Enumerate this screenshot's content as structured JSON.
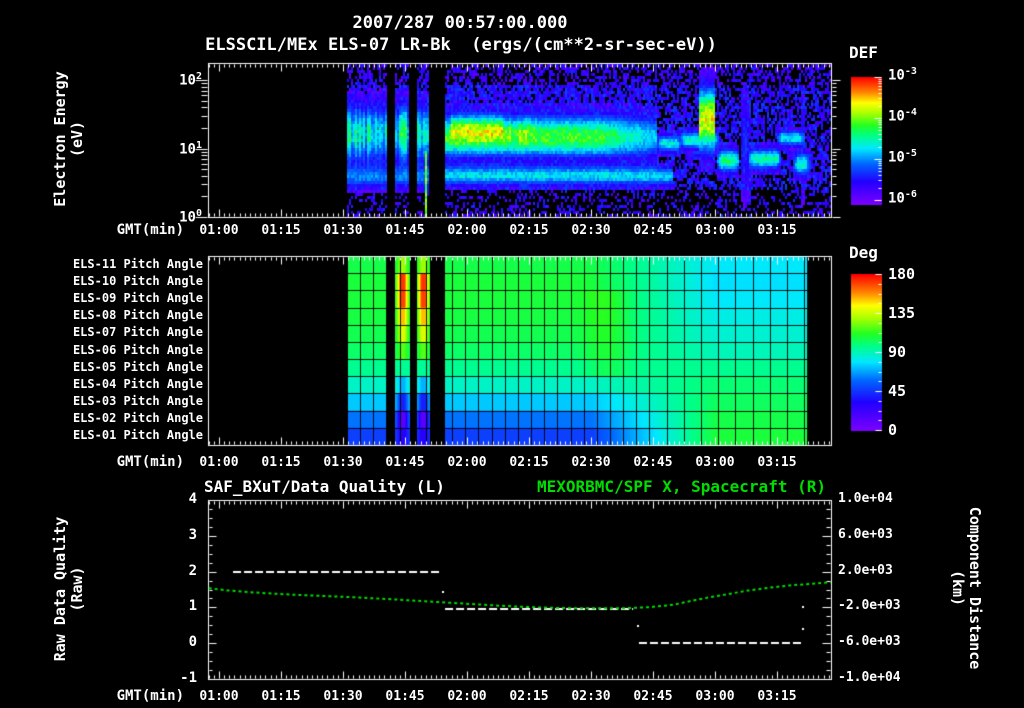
{
  "page": {
    "background": "#000000",
    "text_color": "#ffffff",
    "accent_green": "#00dd00",
    "rainbow_colormap": [
      [
        0.0,
        "#7B00FF"
      ],
      [
        0.18,
        "#2200FF"
      ],
      [
        0.32,
        "#0066FF"
      ],
      [
        0.44,
        "#00E8FF"
      ],
      [
        0.54,
        "#00FF88"
      ],
      [
        0.62,
        "#22FF22"
      ],
      [
        0.72,
        "#AAFF00"
      ],
      [
        0.8,
        "#FFFF00"
      ],
      [
        0.88,
        "#FF8800"
      ],
      [
        1.0,
        "#FF0000"
      ]
    ]
  },
  "header": {
    "title_line1": "2007/287 00:57:00.000",
    "title_line2": "ELSSCIL/MEx ELS-07 LR-Bk  (ergs/(cm**2-sr-sec-eV))"
  },
  "chart_data": [
    {
      "id": "electron-energy-spectrogram",
      "type": "heatmap",
      "x": {
        "label": "GMT(min)",
        "tick_labels": [
          "01:00",
          "01:15",
          "01:30",
          "01:45",
          "02:00",
          "02:15",
          "02:30",
          "02:45",
          "03:00",
          "03:15"
        ],
        "tick_minutes": [
          60,
          75,
          90,
          105,
          120,
          135,
          150,
          165,
          180,
          195
        ],
        "range_minutes": [
          57.34,
          208.06
        ]
      },
      "y": {
        "label_line1": "Electron Energy",
        "label_line2": "(eV)",
        "scale": "log",
        "tick_labels": [
          {
            "base": "10",
            "exp": "2"
          },
          {
            "base": "10",
            "exp": "1"
          },
          {
            "base": "10",
            "exp": "0"
          }
        ],
        "tick_log_values": [
          2,
          1,
          0
        ],
        "range_log_ev": [
          0,
          2.25
        ]
      },
      "colorbar": {
        "title": "DEF",
        "units": "ergs/(cm**2-sr-sec-eV)",
        "tick_labels": [
          {
            "base": "10",
            "exp": "-3"
          },
          {
            "base": "10",
            "exp": "-4"
          },
          {
            "base": "10",
            "exp": "-5"
          },
          {
            "base": "10",
            "exp": "-6"
          }
        ]
      },
      "data_start_min": 91,
      "data_end_min": 208,
      "gaps_min": [
        [
          100.6,
          102.55
        ],
        [
          106.0,
          107.7
        ],
        [
          111.0,
          114.6
        ]
      ],
      "features": {
        "pre_block_streaks": {
          "t": [
            91,
            111
          ],
          "logE_center": 1.22,
          "logE_sigma": 0.42,
          "cyan_center": 0.58,
          "cyan_sigma": 0.16,
          "cyan_intensity": 0.3
        },
        "green_spike": {
          "t": [
            109.85,
            110.5
          ],
          "logE_max": 0.95,
          "intensity": 0.68
        },
        "main_band": {
          "t": [
            114.6,
            166
          ],
          "logE_center": 1.17,
          "logE_sigma": 0.31,
          "intensity": 0.63,
          "fade_after_min": 152
        },
        "yellow_core": {
          "t": [
            116.3,
            128.5
          ],
          "logE_center": 1.31,
          "logE_sigma": 0.19,
          "extra_intensity": 0.21
        },
        "patchy_core": {
          "t": [
            128.5,
            137
          ],
          "logE_center": 1.27,
          "logE_sigma": 0.2,
          "extra_intensity": 0.12
        },
        "cyan_band": {
          "t": [
            114.6,
            170
          ],
          "logE_center": 0.6,
          "logE_sigma": 0.14,
          "intensity": 0.42
        },
        "dark_seam": {
          "logE_center": 0.84,
          "logE_sigma": 0.06,
          "depth": 0.25
        },
        "plume": {
          "t": [
            176.3,
            179.8
          ],
          "logE_center": 1.42,
          "logE_sigma": 0.45,
          "intensity": 0.78
        },
        "blobs": [
          [
            166,
            172,
            0.9,
            1.25,
            0.45
          ],
          [
            171.5,
            181,
            0.95,
            1.3,
            0.5
          ],
          [
            180.5,
            186,
            0.6,
            1.05,
            0.55
          ],
          [
            186.5,
            188,
            0.1,
            2.0,
            0.33
          ],
          [
            188,
            196,
            0.65,
            1.05,
            0.52
          ],
          [
            195,
            202,
            1.0,
            1.3,
            0.46
          ],
          [
            199,
            203,
            0.55,
            1.0,
            0.5
          ],
          [
            200.6,
            201.6,
            0.1,
            2.0,
            0.32
          ]
        ]
      }
    },
    {
      "id": "pitch-angle-heatmap",
      "type": "heatmap",
      "row_labels": [
        "ELS-11 Pitch Angle",
        "ELS-10 Pitch Angle",
        "ELS-09 Pitch Angle",
        "ELS-08 Pitch Angle",
        "ELS-07 Pitch Angle",
        "ELS-06 Pitch Angle",
        "ELS-05 Pitch Angle",
        "ELS-04 Pitch Angle",
        "ELS-03 Pitch Angle",
        "ELS-02 Pitch Angle",
        "ELS-01 Pitch Angle"
      ],
      "x": {
        "label": "GMT(min)",
        "tick_labels": [
          "01:00",
          "01:15",
          "01:30",
          "01:45",
          "02:00",
          "02:15",
          "02:30",
          "02:45",
          "03:00",
          "03:15"
        ],
        "tick_minutes": [
          60,
          75,
          90,
          105,
          120,
          135,
          150,
          165,
          180,
          195
        ]
      },
      "colorbar": {
        "title": "Deg",
        "tick_labels": [
          "180",
          "135",
          "90",
          "45",
          "0"
        ],
        "tick_values": [
          180,
          135,
          90,
          45,
          0
        ],
        "range_deg": [
          0,
          180
        ]
      },
      "data_start_min": 91,
      "data_end_min": 202.3,
      "gaps_min": [
        [
          100.6,
          102.55
        ],
        [
          106.0,
          107.7
        ],
        [
          111.0,
          114.6
        ]
      ],
      "angles_deg_bottom_to_top": {
        "left_and_main": [
          48,
          60,
          74,
          88,
          96,
          102,
          105,
          107,
          108,
          108,
          106
        ],
        "stripe_blocks": [
          30,
          12,
          40,
          70,
          95,
          118,
          138,
          152,
          170,
          172,
          128
        ],
        "stripe_centers_min": [
          104.3,
          109.35
        ],
        "end_state": [
          108,
          106,
          103,
          100,
          96,
          90,
          86,
          83,
          80,
          78,
          80
        ],
        "transition_min": [
          150,
          180
        ]
      }
    },
    {
      "id": "quality-and-distance",
      "type": "line",
      "left_title": "SAF_BXuT/Data Quality (L)",
      "right_title": "MEXORBMC/SPF X, Spacecraft (R)",
      "x": {
        "label": "GMT(min)",
        "tick_labels": [
          "01:00",
          "01:15",
          "01:30",
          "01:45",
          "02:00",
          "02:15",
          "02:30",
          "02:45",
          "03:00",
          "03:15"
        ],
        "tick_minutes": [
          60,
          75,
          90,
          105,
          120,
          135,
          150,
          165,
          180,
          195
        ]
      },
      "left_axis": {
        "label_line1": "Raw Data Quality",
        "label_line2": "(Raw)",
        "tick_labels": [
          "4",
          "3",
          "2",
          "1",
          "0",
          "-1"
        ],
        "tick_values": [
          4,
          3,
          2,
          1,
          0,
          -1
        ],
        "range": [
          -1,
          4
        ]
      },
      "right_axis": {
        "label_line1": "Component Distance",
        "label_line2": "(km)",
        "tick_labels": [
          "1.0e+04",
          "6.0e+03",
          "2.0e+03",
          "-2.0e+03",
          "-6.0e+03",
          "-1.0e+04"
        ],
        "tick_values": [
          10000,
          6000,
          2000,
          -2000,
          -6000,
          -10000
        ],
        "range": [
          -10000,
          10000
        ]
      },
      "series": [
        {
          "name": "SAF_BXuT/Data Quality",
          "axis": "left",
          "color": "#ffffff",
          "line_style": "dashed",
          "steps": [
            {
              "value": 2,
              "t": [
                63.4,
                113.9
              ]
            },
            {
              "value": 0.95,
              "t": [
                114.7,
                160.2
              ]
            },
            {
              "value": 0,
              "t": [
                161.6,
                201.3
              ]
            }
          ],
          "isolated_points": [
            [
              114.2,
              1.42
            ],
            [
              161.4,
              0.47
            ],
            [
              201.3,
              1.0
            ],
            [
              201.3,
              0.39
            ]
          ]
        },
        {
          "name": "MEXORBMC/SPF X Spacecraft Component Distance",
          "axis": "right",
          "color": "#00dd00",
          "line_style": "dashed",
          "points_min_km": [
            [
              57.5,
              150
            ],
            [
              62,
              -100
            ],
            [
              70,
              -380
            ],
            [
              78,
              -580
            ],
            [
              86,
              -740
            ],
            [
              94,
              -900
            ],
            [
              102,
              -1100
            ],
            [
              110,
              -1320
            ],
            [
              118,
              -1540
            ],
            [
              126,
              -1760
            ],
            [
              134,
              -1950
            ],
            [
              142,
              -2070
            ],
            [
              150,
              -2100
            ],
            [
              158,
              -2090
            ],
            [
              164,
              -1980
            ],
            [
              170,
              -1700
            ],
            [
              176,
              -1100
            ],
            [
              182,
              -600
            ],
            [
              188,
              -120
            ],
            [
              193,
              200
            ],
            [
              198,
              450
            ],
            [
              203,
              630
            ],
            [
              208,
              820
            ]
          ]
        }
      ]
    }
  ]
}
